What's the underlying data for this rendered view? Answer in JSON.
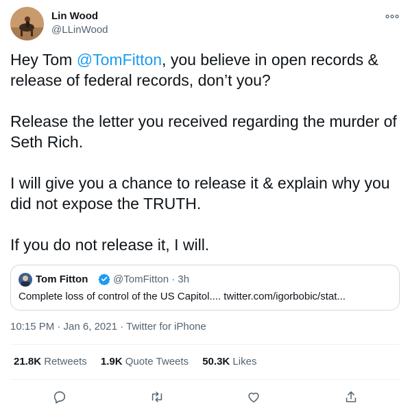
{
  "author": {
    "name": "Lin Wood",
    "handle": "@LLinWood"
  },
  "tweet": {
    "prefix": "Hey Tom ",
    "mention": "@TomFitton",
    "rest": ", you believe in open records & release of federal records, don’t you?\n\nRelease the letter you received regarding the murder of Seth Rich.\n\nI will give you a chance to release it & explain why you did not expose the TRUTH.\n\nIf you do not release it, I will."
  },
  "quoted": {
    "name": "Tom Fitton",
    "meta": "@TomFitton · 3h",
    "text": "Complete loss of control of the US Capitol.... twitter.com/igorbobic/stat..."
  },
  "meta": {
    "timestamp": "10:15 PM · Jan 6, 2021",
    "separator": " · ",
    "source": "Twitter for iPhone"
  },
  "stats": {
    "retweets": {
      "count": "21.8K",
      "label": "Retweets"
    },
    "quotes": {
      "count": "1.9K",
      "label": "Quote Tweets"
    },
    "likes": {
      "count": "50.3K",
      "label": "Likes"
    }
  },
  "actions": [
    "reply-icon",
    "retweet-icon",
    "like-icon",
    "share-icon"
  ],
  "colors": {
    "accent": "#1d9bf0",
    "secondary_text": "#536471",
    "border": "#cfd9de"
  }
}
